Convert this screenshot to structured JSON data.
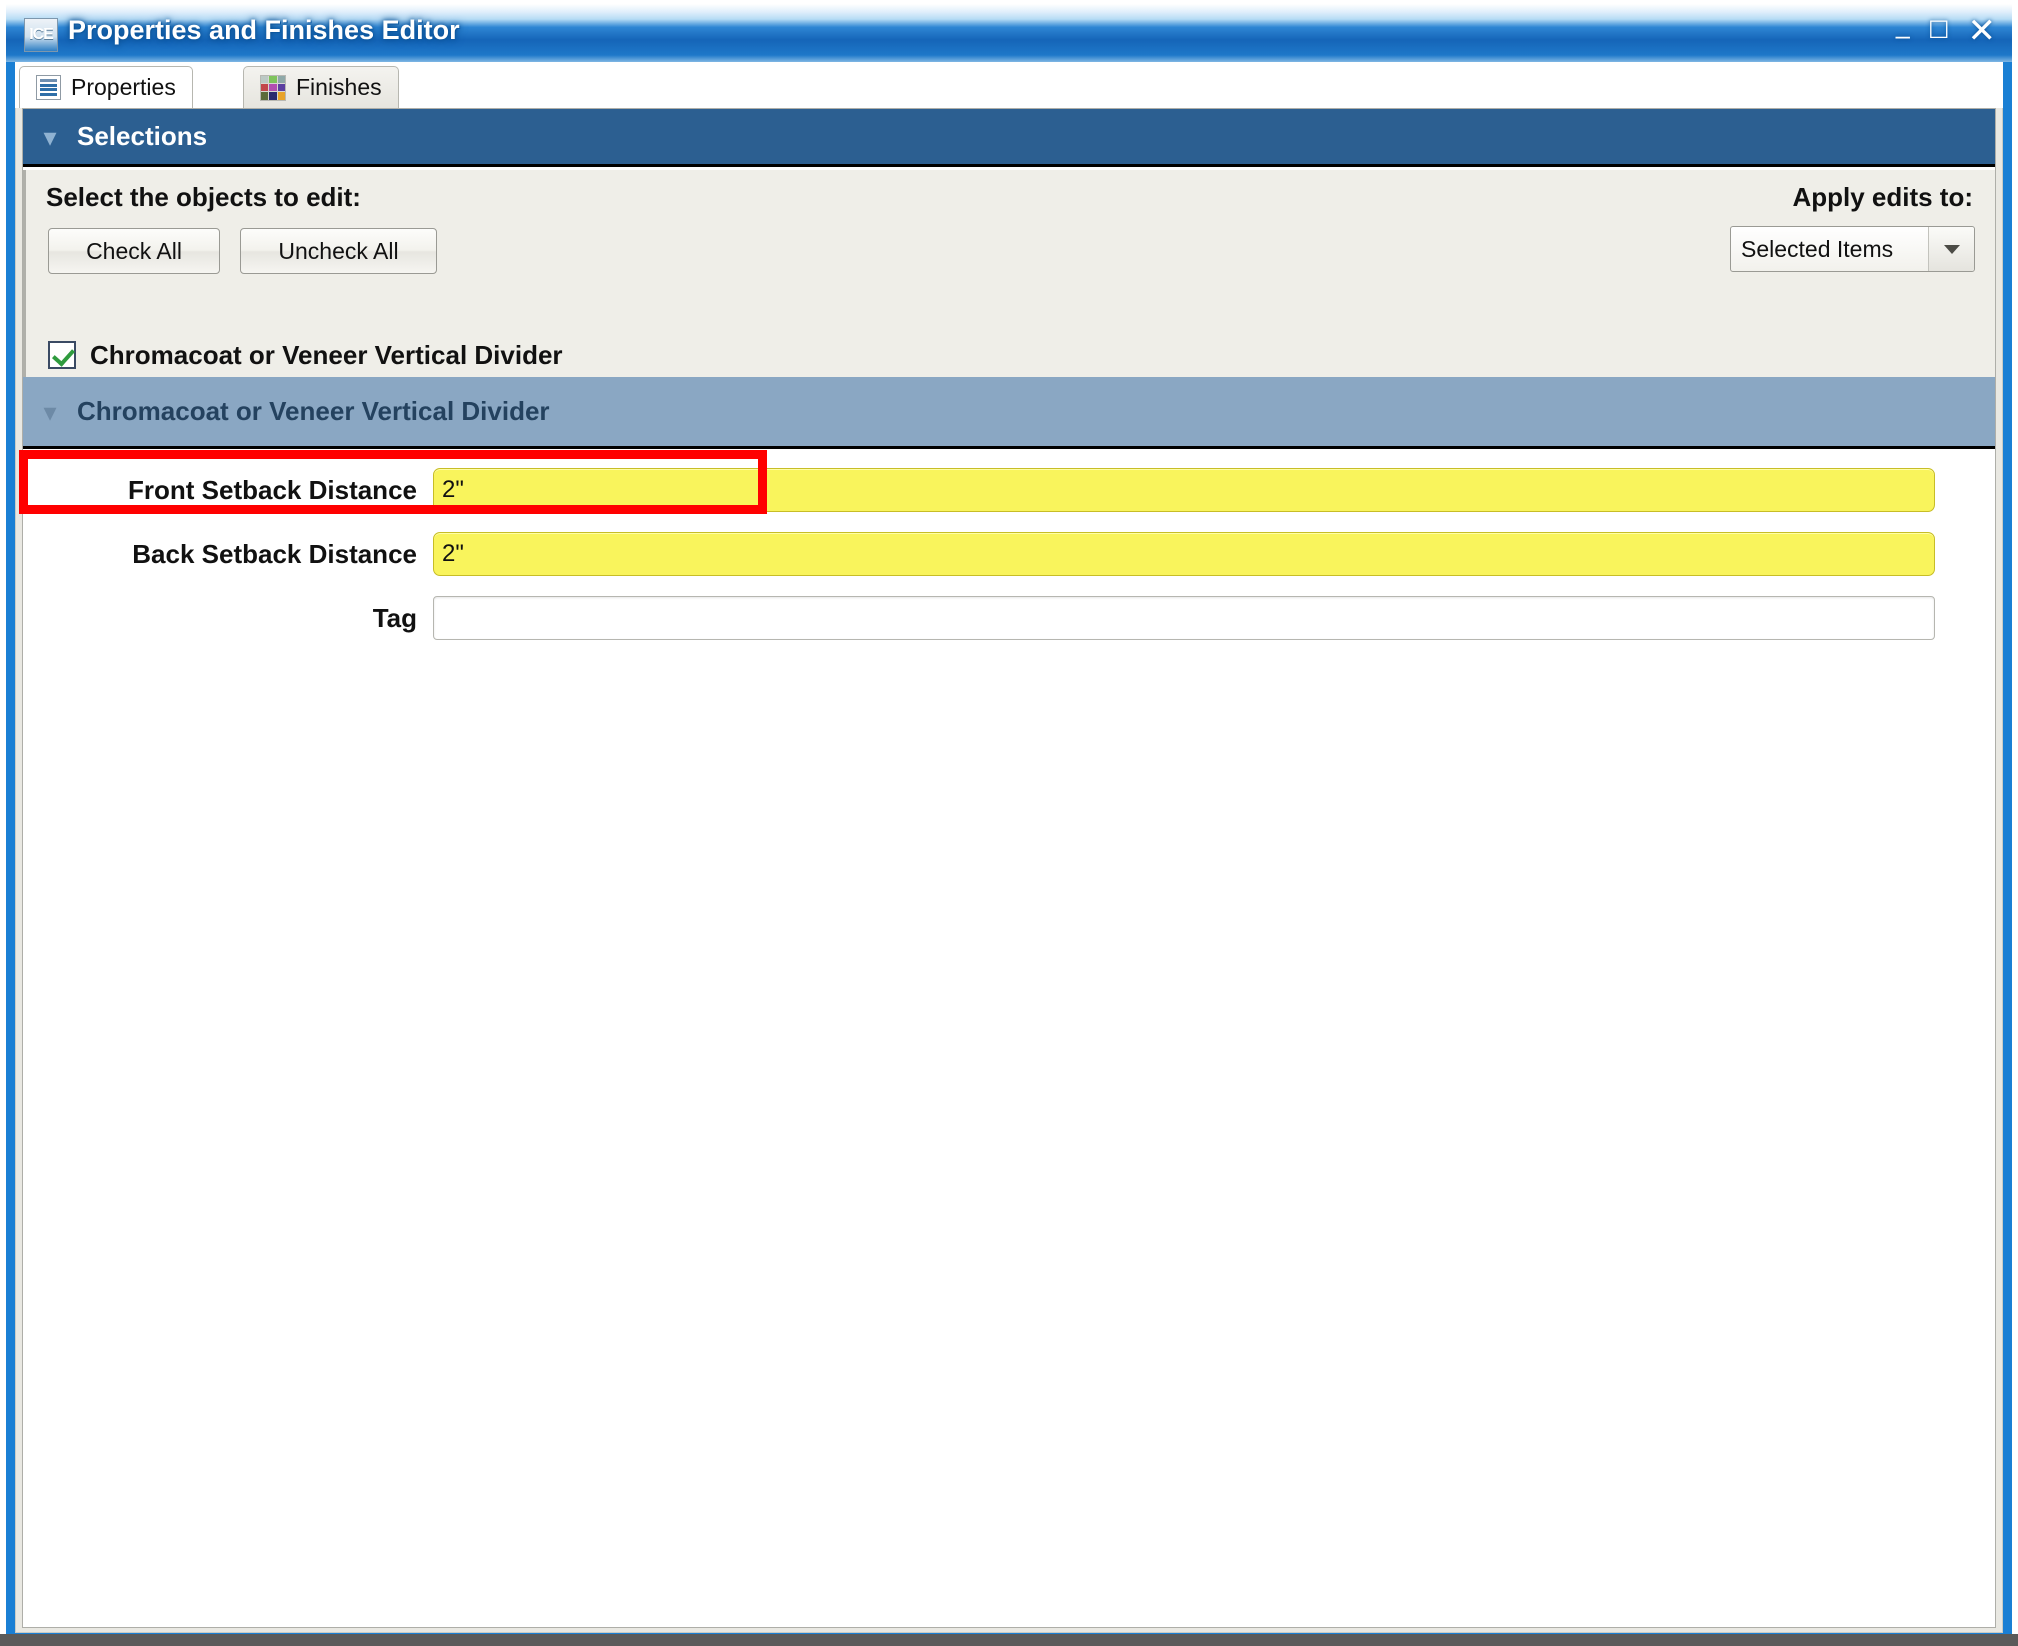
{
  "window": {
    "title": "Properties and Finishes Editor",
    "app_icon_text": "ICE",
    "app_icon_name": "ice-app-icon",
    "controls": {
      "minimize": "–",
      "maximize": "☐",
      "close": "✕"
    }
  },
  "tabs": [
    {
      "label": "Properties",
      "icon": "list-properties-icon",
      "active": true
    },
    {
      "label": "Finishes",
      "icon": "color-swatch-grid-icon",
      "active": false
    }
  ],
  "selections": {
    "header_title": "Selections",
    "collapse_icon": "chevron-down-icon",
    "prompt": "Select the objects to edit:",
    "check_all_label": "Check All",
    "uncheck_all_label": "Uncheck All",
    "apply_label": "Apply edits to:",
    "apply_value": "Selected Items",
    "apply_options": [
      "Selected Items"
    ],
    "objects": [
      {
        "label": "Chromacoat or Veneer Vertical Divider",
        "checked": true,
        "highlighted": true
      }
    ]
  },
  "subsection": {
    "header_title": "Chromacoat or Veneer Vertical Divider",
    "collapse_icon": "chevron-down-icon"
  },
  "fields": [
    {
      "label": "Front Setback Distance",
      "value": "2\"",
      "placeholder": "",
      "style": "yellow"
    },
    {
      "label": "Back Setback Distance",
      "value": "2\"",
      "placeholder": "",
      "style": "yellow"
    },
    {
      "label": "Tag",
      "value": "",
      "placeholder": "",
      "style": "plain"
    }
  ],
  "colors": {
    "titlebar_blue": "#1565b8",
    "window_border_blue": "#1a7fd4",
    "selections_header": "#2c5f91",
    "subsection_header": "#8aa7c3",
    "panel_background": "#efeee8",
    "field_highlight_yellow": "#f9f45c",
    "highlight_outline_red": "#ff0000",
    "checkbox_check_green": "#2f9b3e"
  },
  "finishes_icon_swatches": [
    "#bcc9c4",
    "#7fc45c",
    "#8fa9a8",
    "#c2474b",
    "#b24fb0",
    "#5b3fa0",
    "#5c6b3a",
    "#2a2a6e",
    "#e8a32a"
  ]
}
